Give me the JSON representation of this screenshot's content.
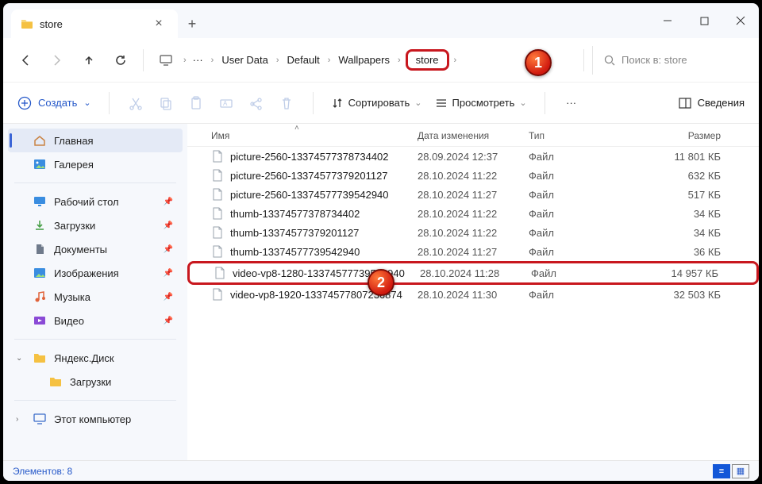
{
  "window": {
    "tab_title": "store"
  },
  "addr": {
    "crumbs": [
      "User Data",
      "Default",
      "Wallpapers",
      "store"
    ],
    "search_placeholder": "Поиск в: store"
  },
  "toolbar": {
    "create": "Создать",
    "sort": "Сортировать",
    "view": "Просмотреть",
    "details": "Сведения"
  },
  "sidebar": {
    "home": "Главная",
    "gallery": "Галерея",
    "desktop": "Рабочий стол",
    "downloads": "Загрузки",
    "documents": "Документы",
    "pictures": "Изображения",
    "music": "Музыка",
    "videos": "Видео",
    "yadisk": "Яндекс.Диск",
    "yadisk_dl": "Загрузки",
    "thispc": "Этот компьютер"
  },
  "columns": {
    "name": "Имя",
    "modified": "Дата изменения",
    "type": "Тип",
    "size": "Размер"
  },
  "files": [
    {
      "name": "picture-2560-13374577378734402",
      "date": "28.09.2024 12:37",
      "type": "Файл",
      "size": "11 801 КБ"
    },
    {
      "name": "picture-2560-13374577379201127",
      "date": "28.10.2024 11:22",
      "type": "Файл",
      "size": "632 КБ"
    },
    {
      "name": "picture-2560-13374577739542940",
      "date": "28.10.2024 11:27",
      "type": "Файл",
      "size": "517 КБ"
    },
    {
      "name": "thumb-13374577378734402",
      "date": "28.10.2024 11:22",
      "type": "Файл",
      "size": "34 КБ"
    },
    {
      "name": "thumb-13374577379201127",
      "date": "28.10.2024 11:22",
      "type": "Файл",
      "size": "34 КБ"
    },
    {
      "name": "thumb-13374577739542940",
      "date": "28.10.2024 11:27",
      "type": "Файл",
      "size": "36 КБ"
    },
    {
      "name": "video-vp8-1280-13374577739542940",
      "date": "28.10.2024 11:28",
      "type": "Файл",
      "size": "14 957 КБ"
    },
    {
      "name": "video-vp8-1920-13374577807236874",
      "date": "28.10.2024 11:30",
      "type": "Файл",
      "size": "32 503 КБ"
    }
  ],
  "status": {
    "count_label": "Элементов: 8"
  },
  "callouts": {
    "c1": "1",
    "c2": "2"
  }
}
